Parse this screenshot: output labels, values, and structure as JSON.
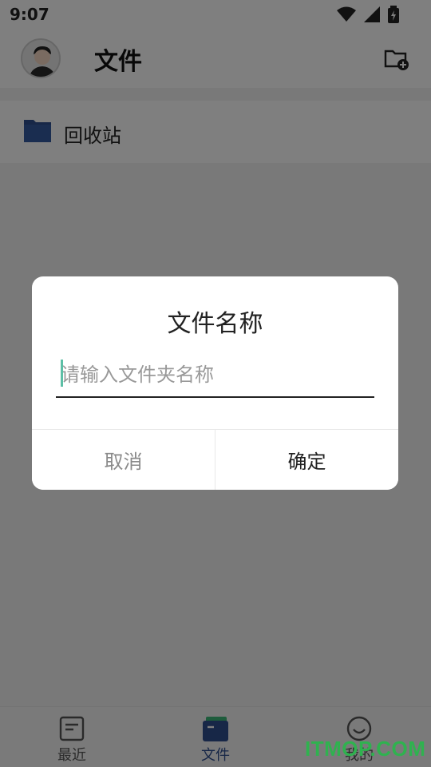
{
  "status": {
    "time": "9:07"
  },
  "appbar": {
    "title": "文件"
  },
  "list": {
    "items": [
      {
        "label": "回收站"
      }
    ]
  },
  "dialog": {
    "title": "文件名称",
    "input_placeholder": "请输入文件夹名称",
    "input_value": "",
    "cancel_label": "取消",
    "ok_label": "确定"
  },
  "tabs": [
    {
      "label": "最近",
      "icon": "recent-doc-icon",
      "active": false
    },
    {
      "label": "文件",
      "icon": "folder-icon",
      "active": true
    },
    {
      "label": "我的",
      "icon": "smile-icon",
      "active": false
    }
  ],
  "colors": {
    "active_tab": "#2f4e8f",
    "inactive_tab": "#555555",
    "folder": "#2f4e8f",
    "caret": "#5cbfa6"
  },
  "watermark": "ITMOP.COM"
}
